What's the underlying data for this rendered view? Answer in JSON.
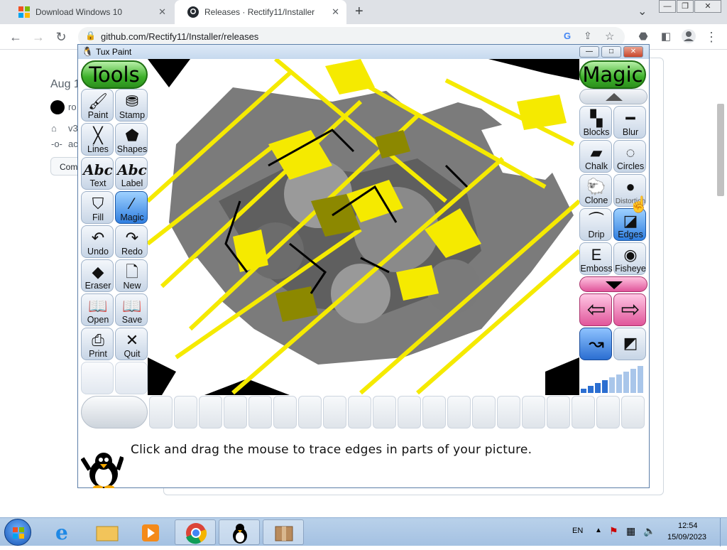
{
  "browser": {
    "tabs": [
      {
        "title": "Download Windows 10",
        "close": "✕"
      },
      {
        "title": "Releases · Rectify11/Installer",
        "close": "✕"
      }
    ],
    "new_tab": "+",
    "dropdown": "⌄",
    "url": "github.com/Rectify11/Installer/releases"
  },
  "github_bg": {
    "date": "Aug 1",
    "user": "ro",
    "tag": "v3",
    "commit": "ac",
    "compare_btn": "Com"
  },
  "tuxpaint": {
    "window_title": "Tux Paint",
    "tools_header": "Tools",
    "magic_header": "Magic",
    "tools": [
      {
        "label": "Paint",
        "icon": "paintbrush-icon",
        "glyph": "🖌"
      },
      {
        "label": "Stamp",
        "icon": "stamp-icon",
        "glyph": "⛃"
      },
      {
        "label": "Lines",
        "icon": "lines-icon",
        "glyph": "╳"
      },
      {
        "label": "Shapes",
        "icon": "pentagon-icon",
        "glyph": "⬟"
      },
      {
        "label": "Text",
        "icon": "text-icon",
        "glyph": "Abc"
      },
      {
        "label": "Label",
        "icon": "label-icon",
        "glyph": "Abc"
      },
      {
        "label": "Fill",
        "icon": "bucket-icon",
        "glyph": "⛉"
      },
      {
        "label": "Magic",
        "icon": "magic-wand-icon",
        "glyph": "⁄"
      },
      {
        "label": "Undo",
        "icon": "undo-icon",
        "glyph": "↶"
      },
      {
        "label": "Redo",
        "icon": "redo-icon",
        "glyph": "↷"
      },
      {
        "label": "Eraser",
        "icon": "eraser-icon",
        "glyph": "◆"
      },
      {
        "label": "New",
        "icon": "new-page-icon",
        "glyph": "🗋"
      },
      {
        "label": "Open",
        "icon": "open-book-icon",
        "glyph": "📖"
      },
      {
        "label": "Save",
        "icon": "save-book-icon",
        "glyph": "📖"
      },
      {
        "label": "Print",
        "icon": "printer-icon",
        "glyph": "⎙"
      },
      {
        "label": "Quit",
        "icon": "quit-icon",
        "glyph": "✕"
      }
    ],
    "magic_tools": [
      {
        "label": "Blocks",
        "icon": "blocks-icon",
        "glyph": "▚"
      },
      {
        "label": "Blur",
        "icon": "blur-icon",
        "glyph": "━"
      },
      {
        "label": "Chalk",
        "icon": "chalk-icon",
        "glyph": "▰"
      },
      {
        "label": "Circles",
        "icon": "circles-icon",
        "glyph": "◌"
      },
      {
        "label": "Clone",
        "icon": "clone-icon",
        "glyph": "🐑"
      },
      {
        "label": "Distortion",
        "icon": "distortion-icon",
        "glyph": "●"
      },
      {
        "label": "Drip",
        "icon": "drip-icon",
        "glyph": "⏜"
      },
      {
        "label": "Edges",
        "icon": "edges-icon",
        "glyph": "◪"
      },
      {
        "label": "Emboss",
        "icon": "emboss-icon",
        "glyph": "E"
      },
      {
        "label": "Fisheye",
        "icon": "fisheye-icon",
        "glyph": "◉"
      }
    ],
    "nav_prev": "⇦",
    "nav_next": "⇨",
    "status": "Click and drag the mouse to trace edges in parts of your picture."
  },
  "taskbar": {
    "language": "EN",
    "time": "12:54",
    "date": "15/09/2023"
  }
}
